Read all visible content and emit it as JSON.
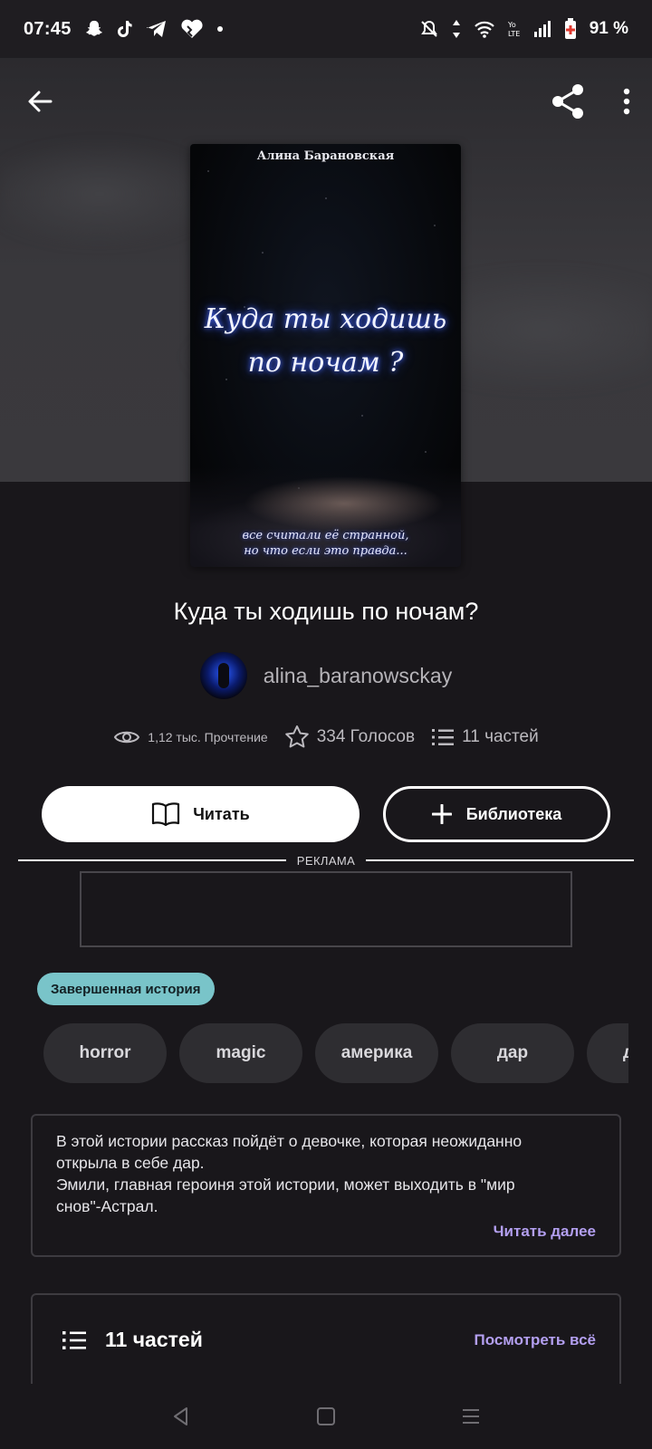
{
  "status_bar": {
    "time": "07:45",
    "battery": "91 %",
    "left_icons": [
      "snapchat-icon",
      "tiktok-icon",
      "telegram-icon",
      "heart-icon",
      "dot-icon"
    ],
    "right_icons": [
      "mute-icon",
      "data-arrows-icon",
      "wifi-icon",
      "volte-icon",
      "signal-icon",
      "battery-icon"
    ]
  },
  "cover": {
    "author": "Алина Барановская",
    "title_line1": "Куда ты ходишь",
    "title_line2": "по ночам ?",
    "tagline_line1": "все считали её странной,",
    "tagline_line2": "но что если это правда..."
  },
  "story": {
    "title": "Куда ты ходишь по ночам?",
    "author": "alina_baranowsckay"
  },
  "stats": {
    "reads": "1,12 тыс. Прочтение",
    "votes": "334 Голосов",
    "parts": "11 частей"
  },
  "buttons": {
    "read": "Читать",
    "library": "Библиотека"
  },
  "ad": {
    "label": "РЕКЛАМА"
  },
  "badge": "Завершенная история",
  "tags": [
    "horror",
    "magic",
    "америка",
    "дар",
    "де"
  ],
  "description": {
    "line1": "В этой истории рассказ пойдёт о девочке, которая неожиданно",
    "line2": "открыла в себе дар.",
    "line3": "Эмили, главная героиня этой истории, может выходить в \"мир",
    "line4": "снов\"-Астрал.",
    "read_more": "Читать далее"
  },
  "parts_section": {
    "title": "11 частей",
    "see_all": "Посмотреть всё"
  },
  "colors": {
    "accent_purple": "#b39ff0",
    "badge_teal": "#79c4c9",
    "background": "#19171b"
  }
}
